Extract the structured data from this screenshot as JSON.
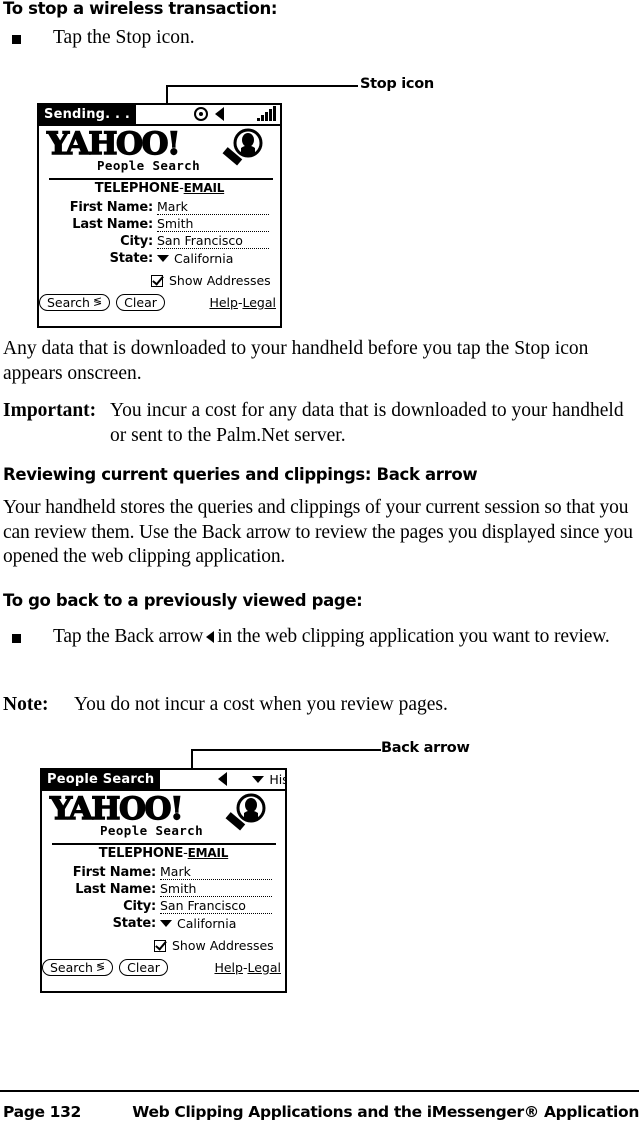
{
  "page": {
    "number_label": "Page 132",
    "footer_title": "Web Clipping Applications and the iMessenger® Application"
  },
  "sections": {
    "stop_transaction": {
      "heading": "To stop a wireless transaction:",
      "bullet": "Tap the Stop icon.",
      "callout_label": "Stop icon",
      "paragraph": "Any data that is downloaded to your handheld before you tap the Stop icon appears onscreen.",
      "important_label": "Important:",
      "important_text": "You incur a cost for any data that is downloaded to your handheld or sent to the Palm.Net server."
    },
    "reviewing": {
      "heading": "Reviewing current queries and clippings: Back arrow",
      "paragraph": "Your handheld stores the queries and clippings of your current session so that you can review them. Use the Back arrow to review the pages you displayed since you opened the web clipping application."
    },
    "go_back": {
      "heading": "To go back to a previously viewed page:",
      "bullet_before_arrow": "Tap the Back arrow",
      "bullet_after_arrow": "in the web clipping application you want to review.",
      "note_label": "Note:",
      "note_text": "You do not incur a cost when you review pages.",
      "callout_label": "Back arrow"
    }
  },
  "screenshot_sending": {
    "title": "Sending. . .",
    "icons": {
      "stop": "stop-icon",
      "back_arrow": "back-arrow-icon",
      "signal": "signal-strength-icon"
    },
    "logo_wordmark": "YAHOO!",
    "logo_subtitle": "People Search",
    "tab_active": "TELEPHONE",
    "tab_separator": "-",
    "tab_inactive": "EMAIL",
    "fields": [
      {
        "label": "First Name:",
        "value": "Mark"
      },
      {
        "label": "Last Name:",
        "value": "Smith"
      },
      {
        "label": "City:",
        "value": "San Francisco"
      }
    ],
    "state_label": "State:",
    "state_value": "California",
    "checkbox_label": "Show Addresses",
    "checkbox_checked": true,
    "search_button": "Search",
    "search_button_glyph": "≶",
    "clear_button": "Clear",
    "help_link": "Help",
    "link_separator": "-",
    "legal_link": "Legal"
  },
  "screenshot_people": {
    "title": "People Search",
    "icons": {
      "back_arrow": "back-arrow-icon",
      "history_chevron": "chevron-down-icon"
    },
    "history_label": "History",
    "logo_wordmark": "YAHOO!",
    "logo_subtitle": "People Search",
    "tab_active": "TELEPHONE",
    "tab_separator": "-",
    "tab_inactive": "EMAIL",
    "fields": [
      {
        "label": "First Name:",
        "value": "Mark"
      },
      {
        "label": "Last Name:",
        "value": "Smith"
      },
      {
        "label": "City:",
        "value": "San Francisco"
      }
    ],
    "state_label": "State:",
    "state_value": "California",
    "checkbox_label": "Show Addresses",
    "checkbox_checked": true,
    "search_button": "Search",
    "search_button_glyph": "≶",
    "clear_button": "Clear",
    "help_link": "Help",
    "link_separator": "-",
    "legal_link": "Legal"
  }
}
